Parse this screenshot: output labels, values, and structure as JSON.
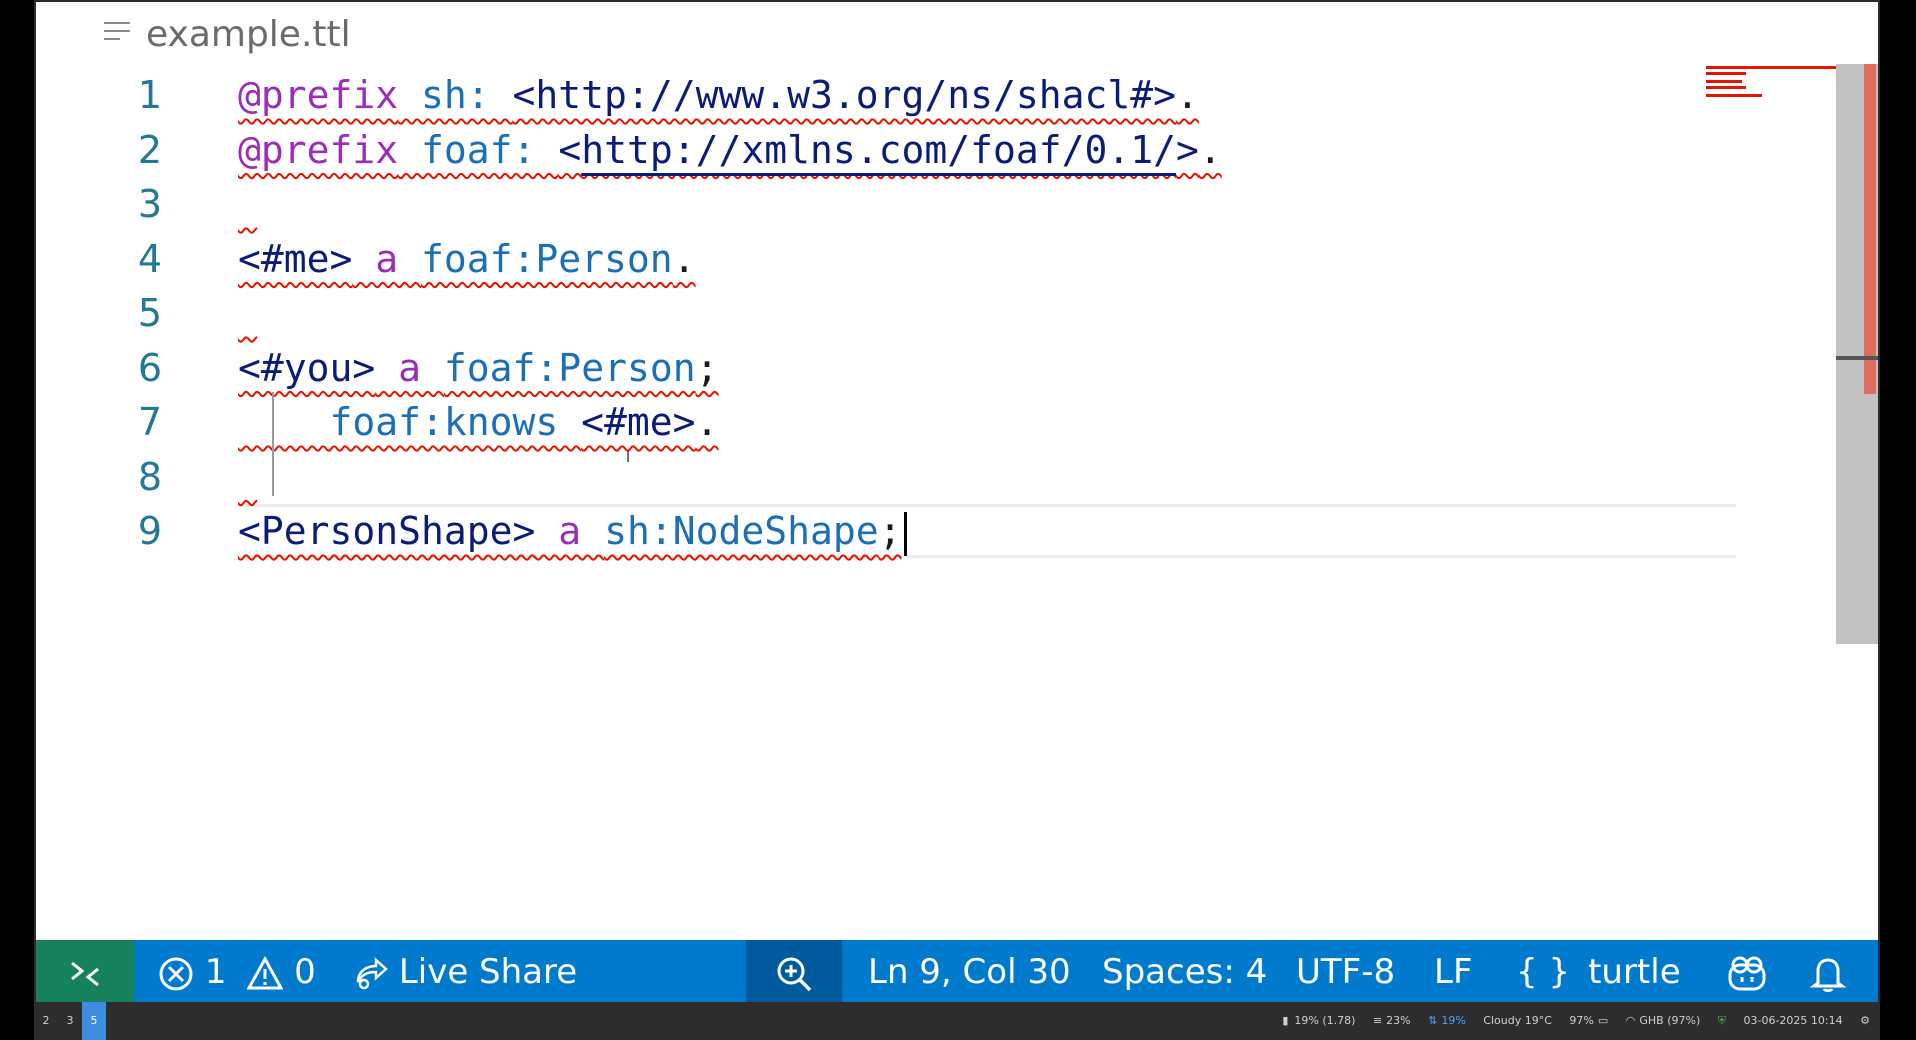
{
  "tab": {
    "filename": "example.ttl"
  },
  "editor": {
    "line_numbers": [
      "1",
      "2",
      "3",
      "4",
      "5",
      "6",
      "7",
      "8",
      "9"
    ],
    "lines": [
      [
        {
          "t": "@prefix",
          "c": "tok-kw"
        },
        {
          "t": " sh: ",
          "c": "tok-pfx"
        },
        {
          "t": "<http://www.w3.org/ns/shacl#>",
          "c": "tok-iri"
        },
        {
          "t": ".",
          "c": "tok-plain"
        }
      ],
      [
        {
          "t": "@prefix",
          "c": "tok-kw"
        },
        {
          "t": " foaf: ",
          "c": "tok-pfx"
        },
        {
          "t": "<",
          "c": "tok-iri"
        },
        {
          "t": "http://xmlns.com/foaf/0.1/",
          "c": "tok-link"
        },
        {
          "t": ">",
          "c": "tok-iri"
        },
        {
          "t": ".",
          "c": "tok-plain"
        }
      ],
      [],
      [
        {
          "t": "<#me>",
          "c": "tok-iri"
        },
        {
          "t": " a ",
          "c": "tok-kw"
        },
        {
          "t": "foaf:Person",
          "c": "tok-pfx"
        },
        {
          "t": ".",
          "c": "tok-plain"
        }
      ],
      [],
      [
        {
          "t": "<#you>",
          "c": "tok-iri"
        },
        {
          "t": " a ",
          "c": "tok-kw"
        },
        {
          "t": "foaf:Person",
          "c": "tok-pfx"
        },
        {
          "t": ";",
          "c": "tok-plain"
        }
      ],
      [
        {
          "t": "    foaf:knows ",
          "c": "tok-pfx"
        },
        {
          "t": "<#me>",
          "c": "tok-iri"
        },
        {
          "t": ".",
          "c": "tok-plain"
        }
      ],
      [],
      [
        {
          "t": "<PersonShape>",
          "c": "tok-iri"
        },
        {
          "t": " a ",
          "c": "tok-kw"
        },
        {
          "t": "sh:NodeShape",
          "c": "tok-pfx"
        },
        {
          "t": ";",
          "c": "tok-plain"
        }
      ]
    ]
  },
  "statusbar": {
    "errors": "1",
    "warnings": "0",
    "live_share": "Live Share",
    "position": "Ln 9, Col 30",
    "spaces": "Spaces: 4",
    "encoding": "UTF-8",
    "eol": "LF",
    "language": "turtle"
  },
  "taskbar": {
    "workspaces": [
      "2",
      "3",
      "5"
    ],
    "active_workspace": "5",
    "tray": {
      "cpu": "19% (1.78)",
      "mem": "23%",
      "net": "19%",
      "weather": "Cloudy 19°C",
      "battery": "97%",
      "wifi": "GHB (97%)",
      "datetime": "03-06-2025 10:14"
    }
  },
  "colors": {
    "statusbar": "#007acc",
    "remote": "#16825d",
    "error_squiggle": "#e51400",
    "line_number": "#237893"
  }
}
